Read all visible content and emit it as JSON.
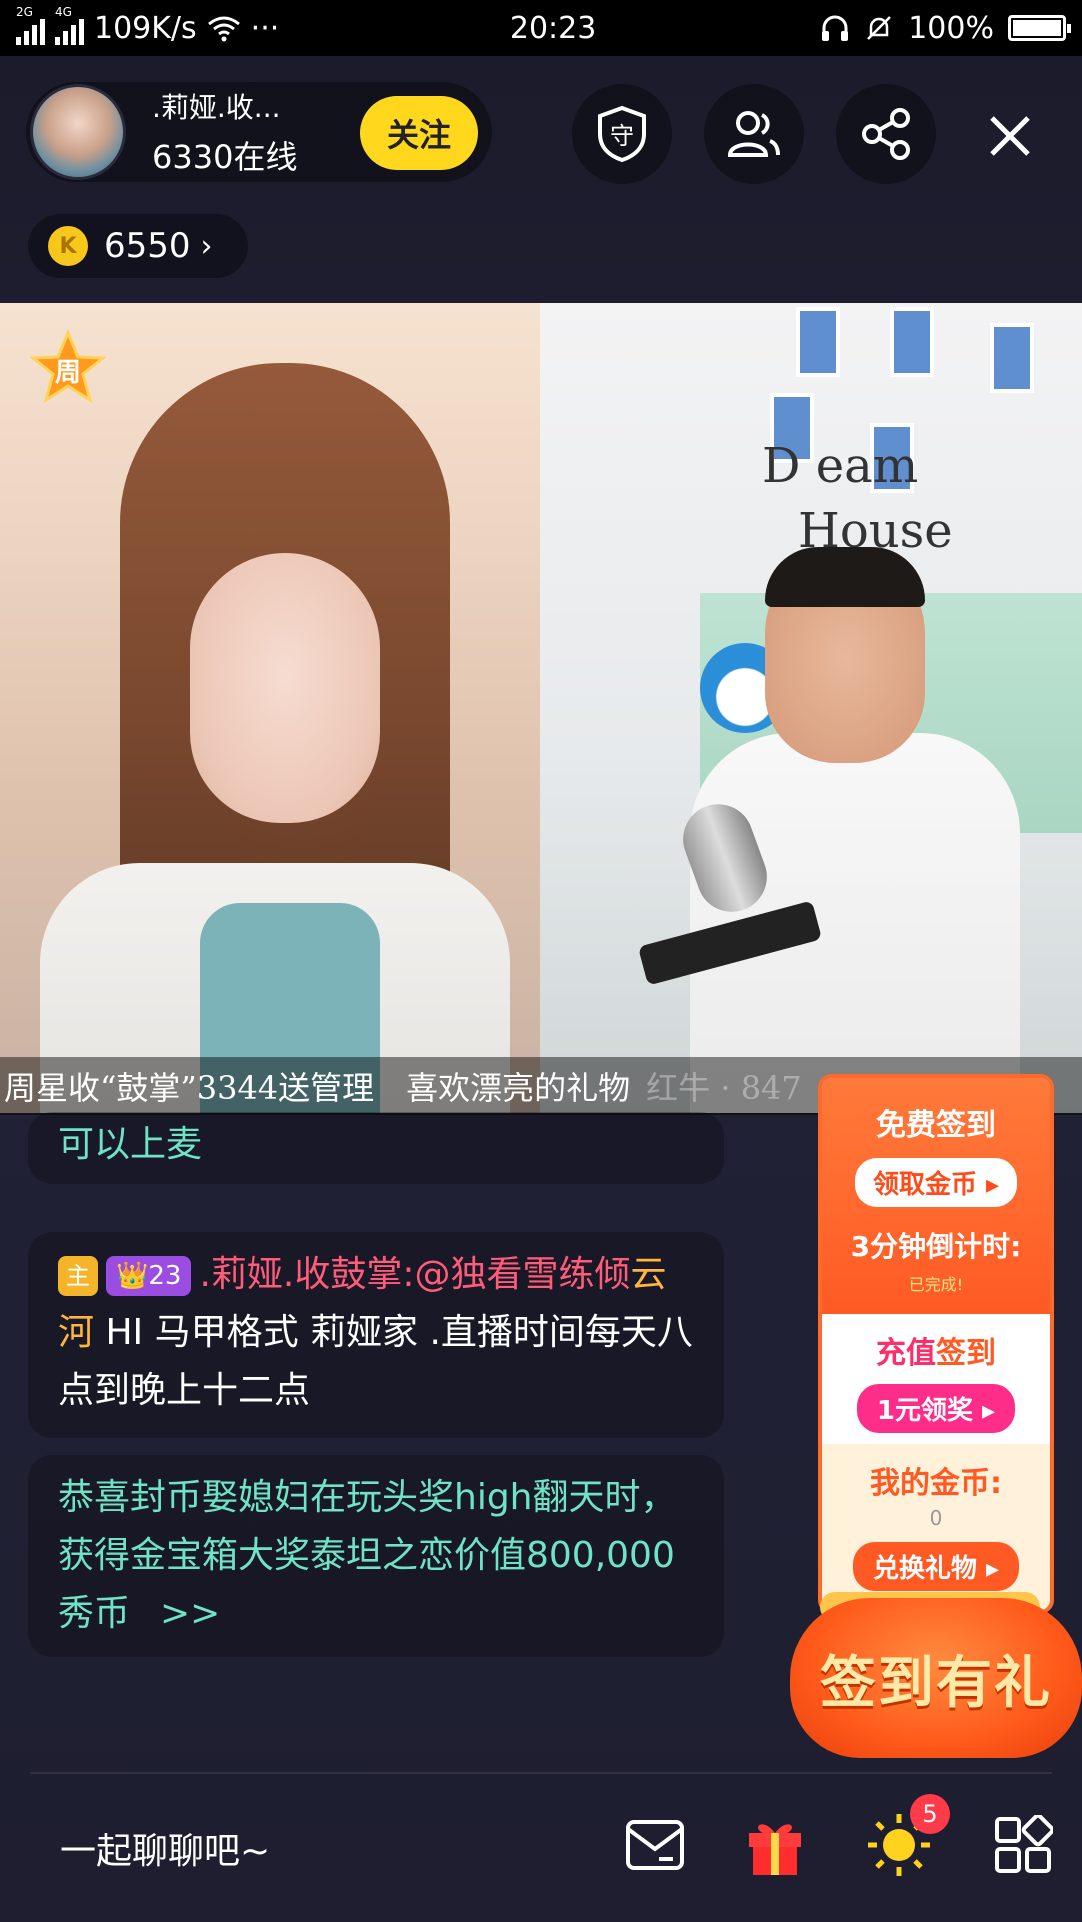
{
  "status_bar": {
    "net_2g": "2G",
    "net_4g": "4G",
    "speed": "109K/s",
    "more": "···",
    "time": "20:23",
    "battery": "100%"
  },
  "header": {
    "anchor_name": ".莉娅.收...",
    "online": "6330在线",
    "follow_label": "关注",
    "guard_icon_text": "守"
  },
  "coins": {
    "value": "6550",
    "icon_text": "K"
  },
  "video": {
    "week_star_label": "周",
    "wall_text_1": "D eam",
    "wall_text_2": "House"
  },
  "marquee": {
    "text": "周星收“鼓掌”3344送管理　喜欢漂亮的礼物",
    "faded": "红牛 · 847"
  },
  "chat": {
    "msg1": "可以上麦",
    "msg2_host_badge": "主",
    "msg2_level": "👑23",
    "msg2_user": ".莉娅.收鼓掌:@独看雪练倾",
    "msg2_user2": "云河",
    "msg2_text": " HI 马甲格式 莉娅家 .直播时间每天八点到晚上十二点",
    "msg3": "恭喜封币娶媳妇在玩头奖high翻天时，获得金宝箱大奖泰坦之恋价值800,000秀币",
    "msg3_more": ">>"
  },
  "signin_panel": {
    "title": "免费签到",
    "claim_coins": "领取金币 ▸",
    "countdown": "3分钟倒计时:",
    "done": "已完成!",
    "recharge_title_a": "充值",
    "recharge_title_b": "签到",
    "recharge_btn": "1元领奖 ▸",
    "my_coins_label": "我的金币:",
    "my_coins_value": "0",
    "exchange_btn": "兑换礼物 ▸",
    "bag_text": "签到有礼"
  },
  "bottom_bar": {
    "input_placeholder": "一起聊聊吧~",
    "badge_count": "5"
  }
}
